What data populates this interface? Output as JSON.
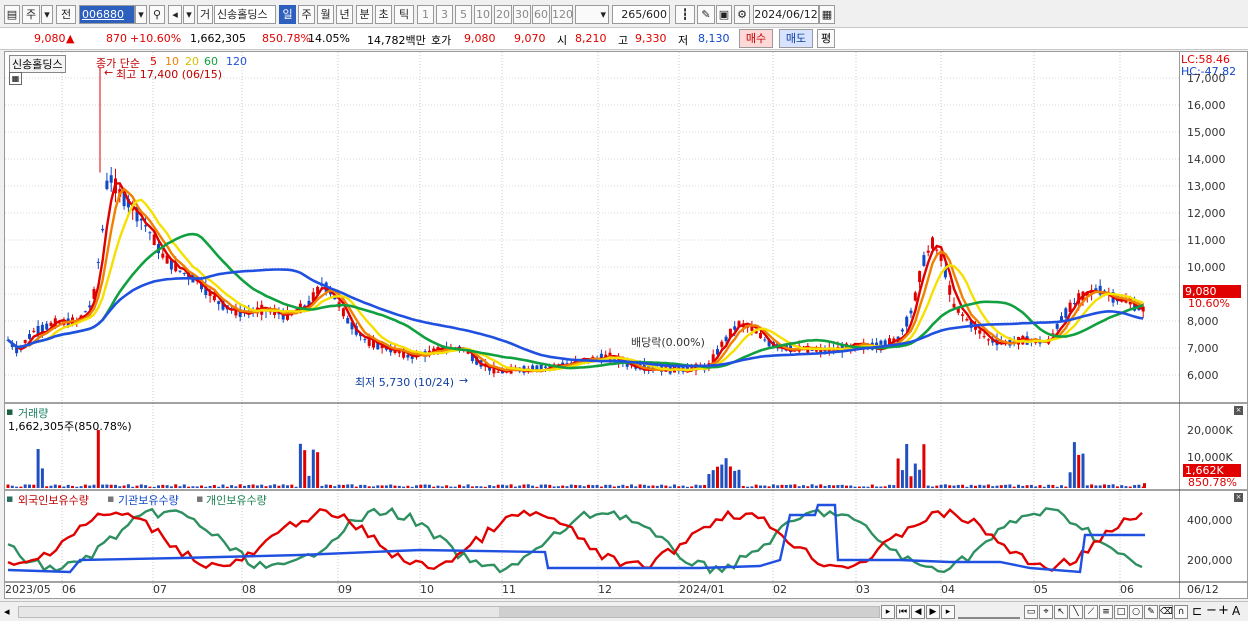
{
  "toolbar": {
    "type1": "주",
    "type2": "전",
    "stock_code": "006880",
    "trade_flag": "거",
    "stock_name": "신송홀딩스",
    "periods": [
      "일",
      "주",
      "월",
      "년",
      "분",
      "초",
      "틱"
    ],
    "active_period": "일",
    "counts": [
      "1",
      "3",
      "5",
      "10",
      "20",
      "30",
      "60",
      "120"
    ],
    "range": "265",
    "range_total": "/600",
    "date": "2024/06/12"
  },
  "quote": {
    "price": "9,080",
    "change": "870",
    "change_pct": "+10.60%",
    "volume": "1,662,305",
    "volume_pct": "850.78%",
    "turnover": "14.05%",
    "amount": "14,782백만",
    "ask_label": "호가",
    "ask": "9,080",
    "bid": "9,070",
    "open_label": "시",
    "open": "8,210",
    "high_label": "고",
    "high": "9,330",
    "low_label": "저",
    "low": "8,130",
    "buy_button": "매수",
    "sell_button": "매도",
    "eval_button": "평"
  },
  "price_pane": {
    "stock_name": "신송홀딩스",
    "ma_title": "종가 단순",
    "ma_periods": [
      "5",
      "10",
      "20",
      "60",
      "120"
    ],
    "ma_colors": [
      "#e00000",
      "#f08000",
      "#f5e000",
      "#10a040",
      "#2050e0"
    ],
    "high_note": "최고 17,400 (06/15)",
    "low_note": "최저 5,730 (10/24)",
    "dividend_note": "배당락(0.00%)",
    "lc": "LC:58.46",
    "hc": "HC:-47.82",
    "price_tag": "9,080",
    "pct_tag": "10.60%",
    "y_ticks": [
      "17,000",
      "16,000",
      "15,000",
      "14,000",
      "13,000",
      "12,000",
      "11,000",
      "10,000",
      "9,000",
      "8,000",
      "7,000",
      "6,000"
    ]
  },
  "volume_pane": {
    "title": "거래량",
    "value": "1,662,305주(850.78%)",
    "y_ticks": [
      "20,000K",
      "10,000K"
    ],
    "tag": "1,662K",
    "pct_tag": "850.78%"
  },
  "holding_pane": {
    "series": [
      "외국인보유수량",
      "기관보유수량",
      "개인보유수량"
    ],
    "y_ticks": [
      "400,000",
      "200,000"
    ]
  },
  "x_axis": [
    "2023/05",
    "06",
    "07",
    "08",
    "09",
    "10",
    "11",
    "12",
    "2024/01",
    "02",
    "03",
    "04",
    "05",
    "06",
    "06/12"
  ]
}
